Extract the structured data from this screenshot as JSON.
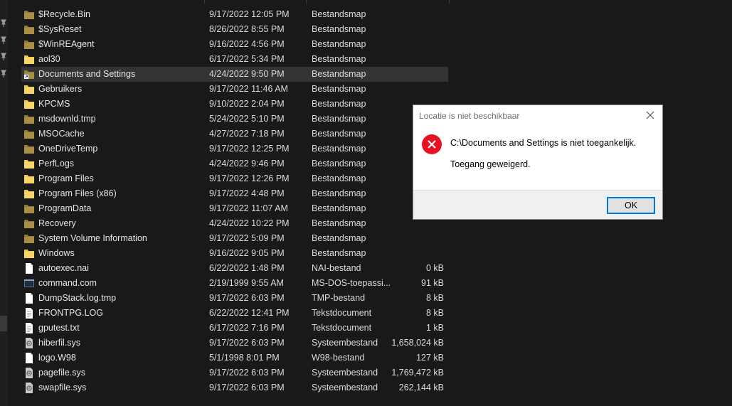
{
  "files": [
    {
      "name": "$Recycle.Bin",
      "date": "9/17/2022 12:05 PM",
      "type": "Bestandsmap",
      "size": "",
      "icon": "folder-dim-icon"
    },
    {
      "name": "$SysReset",
      "date": "8/26/2022 8:55 PM",
      "type": "Bestandsmap",
      "size": "",
      "icon": "folder-dim-icon"
    },
    {
      "name": "$WinREAgent",
      "date": "9/16/2022 4:56 PM",
      "type": "Bestandsmap",
      "size": "",
      "icon": "folder-dim-icon"
    },
    {
      "name": "aol30",
      "date": "6/17/2022 5:34 PM",
      "type": "Bestandsmap",
      "size": "",
      "icon": "folder-icon"
    },
    {
      "name": "Documents and Settings",
      "date": "4/24/2022 9:50 PM",
      "type": "Bestandsmap",
      "size": "",
      "icon": "folder-shortcut-icon"
    },
    {
      "name": "Gebruikers",
      "date": "9/17/2022 11:46 AM",
      "type": "Bestandsmap",
      "size": "",
      "icon": "folder-icon"
    },
    {
      "name": "KPCMS",
      "date": "9/10/2022 2:04 PM",
      "type": "Bestandsmap",
      "size": "",
      "icon": "folder-icon"
    },
    {
      "name": "msdownld.tmp",
      "date": "5/24/2022 5:10 PM",
      "type": "Bestandsmap",
      "size": "",
      "icon": "folder-dim-icon"
    },
    {
      "name": "MSOCache",
      "date": "4/27/2022 7:18 PM",
      "type": "Bestandsmap",
      "size": "",
      "icon": "folder-dim-icon"
    },
    {
      "name": "OneDriveTemp",
      "date": "9/17/2022 12:25 PM",
      "type": "Bestandsmap",
      "size": "",
      "icon": "folder-dim-icon"
    },
    {
      "name": "PerfLogs",
      "date": "4/24/2022 9:46 PM",
      "type": "Bestandsmap",
      "size": "",
      "icon": "folder-icon"
    },
    {
      "name": "Program Files",
      "date": "9/17/2022 12:26 PM",
      "type": "Bestandsmap",
      "size": "",
      "icon": "folder-icon"
    },
    {
      "name": "Program Files (x86)",
      "date": "9/17/2022 4:48 PM",
      "type": "Bestandsmap",
      "size": "",
      "icon": "folder-icon"
    },
    {
      "name": "ProgramData",
      "date": "9/17/2022 11:07 AM",
      "type": "Bestandsmap",
      "size": "",
      "icon": "folder-dim-icon"
    },
    {
      "name": "Recovery",
      "date": "4/24/2022 10:22 PM",
      "type": "Bestandsmap",
      "size": "",
      "icon": "folder-dim-icon"
    },
    {
      "name": "System Volume Information",
      "date": "9/17/2022 5:09 PM",
      "type": "Bestandsmap",
      "size": "",
      "icon": "folder-dim-icon"
    },
    {
      "name": "Windows",
      "date": "9/16/2022 9:05 PM",
      "type": "Bestandsmap",
      "size": "",
      "icon": "folder-icon"
    },
    {
      "name": "autoexec.nai",
      "date": "6/22/2022 1:48 PM",
      "type": "NAI-bestand",
      "size": "0 kB",
      "icon": "file-icon"
    },
    {
      "name": "command.com",
      "date": "2/19/1999 9:55 AM",
      "type": "MS-DOS-toepassi...",
      "size": "91 kB",
      "icon": "msdos-app-icon"
    },
    {
      "name": "DumpStack.log.tmp",
      "date": "9/17/2022 6:03 PM",
      "type": "TMP-bestand",
      "size": "8 kB",
      "icon": "file-icon"
    },
    {
      "name": "FRONTPG.LOG",
      "date": "6/22/2022 12:41 PM",
      "type": "Tekstdocument",
      "size": "8 kB",
      "icon": "text-file-icon"
    },
    {
      "name": "gputest.txt",
      "date": "6/17/2022 7:16 PM",
      "type": "Tekstdocument",
      "size": "1 kB",
      "icon": "text-file-icon"
    },
    {
      "name": "hiberfil.sys",
      "date": "9/17/2022 6:03 PM",
      "type": "Systeembestand",
      "size": "1,658,024 kB",
      "icon": "system-file-icon"
    },
    {
      "name": "logo.W98",
      "date": "5/1/1998 8:01 PM",
      "type": "W98-bestand",
      "size": "127 kB",
      "icon": "file-icon"
    },
    {
      "name": "pagefile.sys",
      "date": "9/17/2022 6:03 PM",
      "type": "Systeembestand",
      "size": "1,769,472 kB",
      "icon": "system-file-icon"
    },
    {
      "name": "swapfile.sys",
      "date": "9/17/2022 6:03 PM",
      "type": "Systeembestand",
      "size": "262,144 kB",
      "icon": "system-file-icon"
    }
  ],
  "dialog": {
    "title": "Locatie is niet beschikbaar",
    "message": "C:\\Documents and Settings is niet toegankelijk.",
    "detail": "Toegang geweigerd.",
    "ok_label": "OK",
    "icon": "error-icon",
    "close_icon": "close-icon"
  },
  "colors": {
    "background": "#191919",
    "folder": "#f2c84b",
    "folder_dim": "#a98e45",
    "error_red": "#e81123",
    "accent": "#0078d7"
  }
}
